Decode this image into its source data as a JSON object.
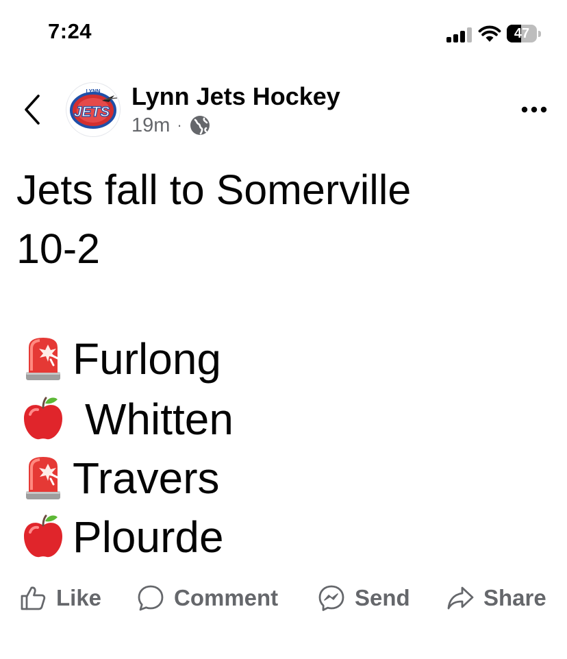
{
  "status_bar": {
    "time": "7:24",
    "battery_level": "47",
    "battery_fraction": 0.47
  },
  "post": {
    "page_name": "Lynn Jets Hockey",
    "avatar_text": "JETS",
    "avatar_top_text": "LYNN",
    "timestamp": "19m",
    "separator": "·",
    "audience_icon": "globe-icon",
    "title_line1": "Jets fall to Somerville",
    "title_line2": "10-2",
    "scorers": [
      {
        "icon": "siren-icon",
        "name": "Furlong"
      },
      {
        "icon": "apple-icon",
        "name": "Whitten"
      },
      {
        "icon": "siren-icon",
        "name": "Travers"
      },
      {
        "icon": "apple-icon",
        "name": "Plourde"
      }
    ]
  },
  "actions": {
    "like": "Like",
    "comment": "Comment",
    "send": "Send",
    "share": "Share"
  },
  "colors": {
    "text": "#050505",
    "secondary": "#65676b",
    "avatar_red": "#d32f2f",
    "avatar_blue": "#1f4fa8"
  }
}
